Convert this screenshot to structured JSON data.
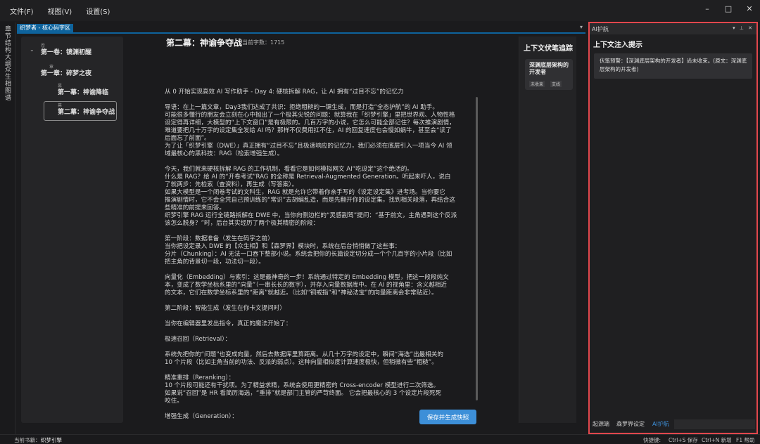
{
  "menu": [
    "文件(F)",
    "视图(V)",
    "设置(S)"
  ],
  "window_controls": [
    "–",
    "□",
    "✕"
  ],
  "left_strip": {
    "tab1": "章节结构大纲",
    "tab2": "众生相图谱"
  },
  "doc_tab": {
    "label": "织梦者 - 核心码字区",
    "arrow": "▾"
  },
  "tree": [
    {
      "kind": "卷",
      "label": "第一卷：镜渊初醒",
      "expander": "⌄"
    },
    {
      "kind": "章",
      "label": "第一章：碎梦之夜",
      "expander": "⌄"
    },
    {
      "kind": "幕",
      "label": "第一幕：神谕降临"
    },
    {
      "kind": "幕",
      "label": "第二幕：神谕争夺战"
    }
  ],
  "editor": {
    "title": "第二幕：神谕争夺战",
    "word_count_label": "当前字数：1715",
    "lines": [
      "从 0 开始实现高效 AI 写作助手 - Day 4: 硬核拆解 RAG，让 AI 拥有“过目不忘”的记忆力",
      "",
      "      导语：在上一篇文章，Day3我们达成了共识：拒绝粗糙的一键生成，而是打造“全态护航”的 AI 助手。",
      "可能很多懂行的朋友会立刻在心中抛出了一个极其尖锐的问题：就算我在「织梦引擎」里把世界观、人物性格",
      "设定得再详细，大模型的“上下文窗口”是有极限的。几百万字的小说，它怎么可能全部记住？每次推演剧情，",
      "难道要把几十万字的设定集全发给 AI 吗？那样不仅费用扛不住，AI 的回复速度也会慢如蜗牛，甚至会“读了",
      "后面忘了前面”。",
      "为了让「织梦引擎（DWE）」真正拥有“过目不忘”且极速响应的记忆力，我们必须在底层引入一项当今 AI 领",
      "域最核心的黑科技：RAG（检索增强生成）。",
      "",
      "      今天，我们就来硬核拆解 RAG 的工作机制，看看它是如何模拟网文 AI“吃设定”这个绝活的。",
      "什么是 RAG？给 AI 的“开卷考试”RAG 的全称是 Retrieval-Augmented Generation。听起来吓人，说白",
      "了就两步：先检索（查资料），再生成（写答案）。",
      "      如果大模型是一个闭卷考试的文科生，RAG 就是允许它带着你亲手写的《设定设定集》进考场。当你要它",
      "推演剧情时，它不会全凭自己预训练的“常识”去胡编乱造，而是先翻开你的设定集，找到相关段落，再结合这",
      "些精准的前提来回答。",
      "织梦引擎 RAG 运行全链路拆解在 DWE 中，当你向侧边栏的“灵感副驾”提问：“基于前文，主角遇到这个反派",
      "该怎么脱身？”时，后台其实经历了两个极其精密的阶段：",
      "",
      "第一阶段：数据准备（发生在码字之前）",
      "      当你把设定录入 DWE 的【众生相】和【森罗界】模块时，系统在后台悄悄做了这些事：",
      "分片（Chunking）：AI 无法一口吞下整部小说。系统会把你的长篇设定切分成一个个几百字的小片段（比如",
      "把主角的背景切一段，功法切一段）。",
      "",
      "      向量化（Embedding）与索引：这是最神奇的一步！系统通过特定的 Embedding 模型，把这一段段纯文",
      "本，变成了数学坐标系里的“向量”（一串长长的数字），并存入向量数据库中。在 AI 的视角里：含义越相近",
      "的文本，它们在数学坐标系里的“距离”就越近。（比如“铜戒指”和“神秘法宝”的向量距离会非常贴近）。",
      "",
      "第二阶段：智能生成（发生在你卡文提问时）",
      "",
      "当你在编辑器里发出指令，真正的魔法开始了：",
      "",
      "极速召回（Retrieval）：",
      "",
      "      系统先把你的“问题”也变成向量，然后去数据库里算距离。从几十万字的设定中，瞬间“海选”出最相关的",
      "10 个片段（比如主角当前的功法、反派的弱点）。这种向量相似度计算速度极快，但稍微有些“粗糙”。",
      "",
      "精准重排（Reranking）：",
      "      10 个片段可能还有干扰项。为了精益求精，系统会使用更精密的 Cross-encoder 模型进行二次筛选。",
      "如果说“召回”是 HR 看简历海选，“重排”就是部门主管的严苛终面。 它会把最核心的 3 个设定片段死死",
      "咬住。",
      "",
      "增强生成（Generation）："
    ],
    "save_button": "保存并生成快照"
  },
  "foreshadow": {
    "title": "上下文伏笔追踪",
    "card_name": "深渊底层架构的开发者",
    "tag_status": "未收束",
    "tag_action": "支线"
  },
  "ai_panel": {
    "header": "AI护航",
    "header_icons": "▾ ⊥ ✕",
    "title": "上下文注入提示",
    "warning": "伏笔预警：【深渊底层架构的开发者】尚未收束。(原文：深渊底层架构的开发者)",
    "tabs": [
      "起源端",
      "森罗界设定",
      "AI护航"
    ]
  },
  "statusbar": {
    "book_prefix": "当前书籍：",
    "book_name": "织梦引擎",
    "shortcut_label": "快捷键:",
    "save_shortcut": "Ctrl+S 保存",
    "new_shortcut": "Ctrl+N 新增",
    "help_shortcut": "F1 帮助"
  }
}
